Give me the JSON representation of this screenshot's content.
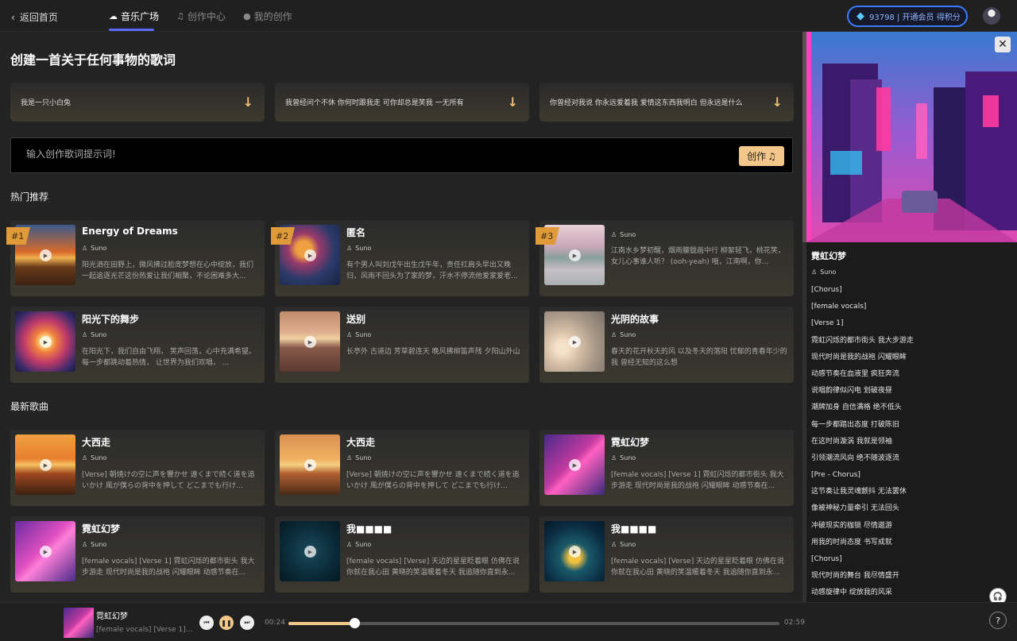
{
  "nav": {
    "back": "返回首页",
    "tabs": [
      {
        "label": "音乐广场"
      },
      {
        "label": "创作中心"
      },
      {
        "label": "我的创作"
      }
    ],
    "vip": "93798 | 开通会员 得积分"
  },
  "main": {
    "heading": "创建一首关于任何事物的歌词",
    "prompts": [
      "我是一只小白兔",
      "我曾经问个不休 你何时跟我走 可你却总是笑我 一无所有",
      "你曾经对我说 你永远爱着我 爱情这东西我明白 但永远是什么"
    ],
    "input_placeholder": "输入创作歌词提示词!",
    "create_label": "创作",
    "hot_title": "热门推荐",
    "new_title": "最新歌曲",
    "hot": [
      {
        "rank": "#1",
        "title": "Energy of Dreams",
        "author": "Suno",
        "desc": "阳光洒在田野上，微风拂过脸庞梦想在心中绽放，我们一起追逐光芒这份热爱让我们相聚，不论困难多大..."
      },
      {
        "rank": "#2",
        "title": "匿名",
        "author": "Suno",
        "desc": "有个男人叫刘戊午出生戊午年，责任扛肩头早出又晚归，风雨不回头为了家的梦，汗水不停流他爱家爱老..."
      },
      {
        "rank": "#3",
        "title": "",
        "author": "Suno",
        "desc": "江南水乡梦初醒，烟雨朦胧画中行 柳絮轻飞，桃花笑，女儿心事谁人听？ (ooh-yeah) 哦，江南啊，你..."
      },
      {
        "title": "阳光下的舞步",
        "author": "Suno",
        "desc": "在阳光下，我们自由飞翔， 笑声回荡，心中充满希望。 每一步都跳动着热情， 让世界为我们欢唱， ..."
      },
      {
        "title": "送别",
        "author": "Suno",
        "desc": "长亭外 古道边 芳草碧连天 晚风拂柳笛声残 夕阳山外山"
      },
      {
        "title": "光阴的故事",
        "author": "Suno",
        "desc": "春天的花开秋天的风 以及冬天的落阳 忧郁的青春年少的我 曾经无知的这么想"
      }
    ],
    "latest": [
      {
        "title": "大西走",
        "author": "Suno",
        "desc": "[Verse] 朝焼けの空に声を響かせ 遠くまで続く道を追いかけ 風が僕らの背中を押して どこまでも行け..."
      },
      {
        "title": "大西走",
        "author": "Suno",
        "desc": "[Verse] 朝焼けの空に声を響かせ 遠くまで続く道を追いかけ 風が僕らの背中を押して どこまでも行け..."
      },
      {
        "title": "霓虹幻梦",
        "author": "Suno",
        "desc": "[female vocals] [Verse 1] 霓虹闪烁的都市街头 我大步游走 现代时尚是我的战袍 闪耀眼眸 动感节奏在..."
      },
      {
        "title": "霓虹幻梦",
        "author": "Suno",
        "desc": "[female vocals] [Verse 1] 霓虹闪烁的都市街头 我大步游走 现代时尚是我的战袍 闪耀眼眸 动感节奏在..."
      },
      {
        "title": "我■■■■",
        "author": "Suno",
        "desc": "[female vocals] [Verse] 天边的星星眨着眼 仿佛在说你就在我心田 黄晓的笑温暖着冬天 我追随你直到永..."
      },
      {
        "title": "我■■■■",
        "author": "Suno",
        "desc": "[female vocals] [Verse] 天边的星星眨着眼 仿佛在说你就在我心田 黄晓的笑温暖着冬天 我追随你直到永..."
      }
    ]
  },
  "side": {
    "title": "霓虹幻梦",
    "author": "Suno",
    "lyrics": [
      "[Chorus]",
      "[female vocals]",
      "[Verse 1]",
      "霓虹闪烁的都市街头 我大步游走",
      "现代时尚是我的战袍 闪耀眼眸",
      "动感节奏在血液里 疯狂奔流",
      "说唱韵律似闪电 划破夜昼",
      "潮牌加身 自信满格 绝不低头",
      "每一步都踏出态度 打破陈旧",
      "在这时尚漩涡 我就是领袖",
      "引领潮流风向 绝不随波逐流",
      "[Pre - Chorus]",
      "这节奏让我灵魂颤抖 无法罢休",
      "像被神秘力量牵引 无法回头",
      "冲破现实的枷锁 尽情遨游",
      "用我的时尚态度 书写成就",
      "[Chorus]",
      "现代时尚的舞台 我尽情盛开",
      "动感旋律中 绽放我的风采"
    ]
  },
  "player": {
    "title": "霓虹幻梦",
    "subtitle": "[female vocals] [Verse 1]...",
    "current": "00:24",
    "total": "02:59",
    "progress": 0.134
  },
  "colors": {
    "accent": "#f3c78a",
    "rank": "#e09a37",
    "tab_underline": "#5b6bff",
    "vip_border": "#3a7bff"
  },
  "icons": [
    "chevron-left-icon",
    "music-note-icon",
    "diamond-icon",
    "user-icon",
    "play-icon",
    "arrow-down-icon",
    "close-icon",
    "prev-icon",
    "pause-icon",
    "next-icon",
    "headset-icon",
    "help-icon"
  ]
}
